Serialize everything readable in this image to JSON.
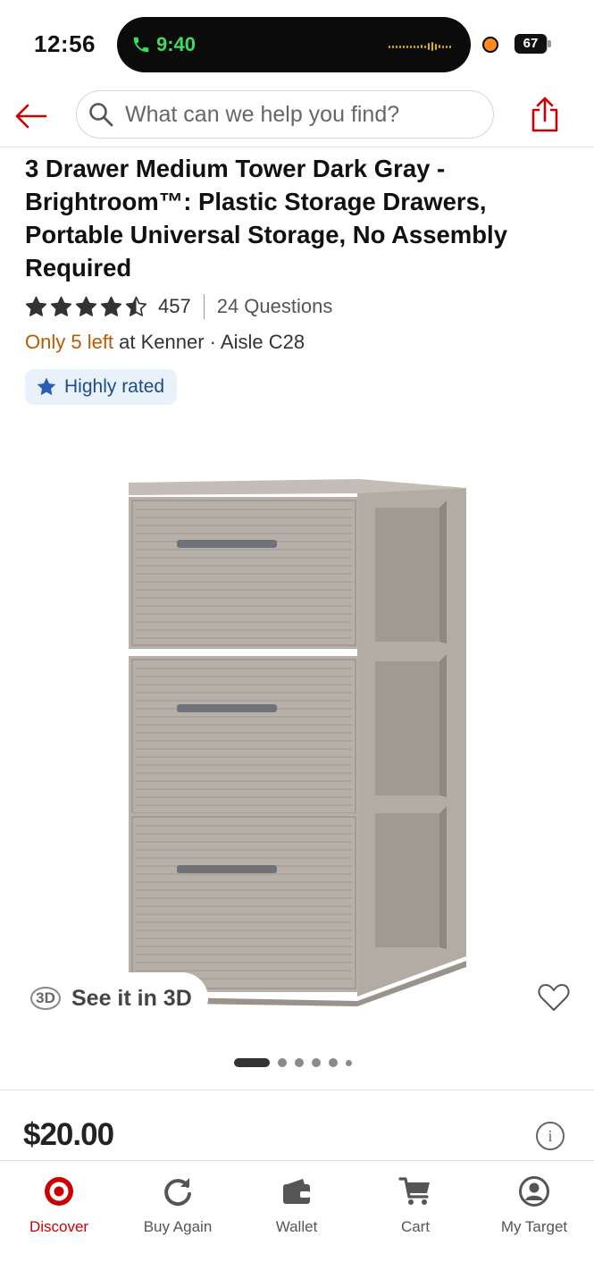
{
  "status_bar": {
    "time": "12:56",
    "call_time": "9:40",
    "battery": "67"
  },
  "header": {
    "search_placeholder": "What can we help you find?",
    "back_icon": "arrow-left-icon",
    "share_icon": "share-icon"
  },
  "product": {
    "title": "3 Drawer Medium Tower Dark Gray - Brightroom™: Plastic Storage Drawers, Portable Universal Storage, No Assembly Required",
    "rating_stars": 4.5,
    "review_count": "457",
    "questions": "24 Questions",
    "stock_left": "Only 5 left",
    "stock_location": " at Kenner · Aisle C28",
    "badge": "Highly rated",
    "see_3d_label": "See it in 3D",
    "see_3d_icon_text": "3D",
    "price": "$20.00",
    "carousel": {
      "count": 6,
      "active_index": 0
    }
  },
  "bottom_nav": {
    "items": [
      {
        "label": "Discover",
        "icon": "target-logo-icon",
        "active": true
      },
      {
        "label": "Buy Again",
        "icon": "refresh-icon",
        "active": false
      },
      {
        "label": "Wallet",
        "icon": "wallet-icon",
        "active": false
      },
      {
        "label": "Cart",
        "icon": "cart-icon",
        "active": false
      },
      {
        "label": "My Target",
        "icon": "account-icon",
        "active": false
      }
    ]
  },
  "colors": {
    "brand_red": "#cc0000",
    "stock_orange": "#b85b00",
    "badge_bg": "#e9f1fb",
    "badge_blue": "#2a5bb5",
    "product_gray": "#aaa39c"
  }
}
